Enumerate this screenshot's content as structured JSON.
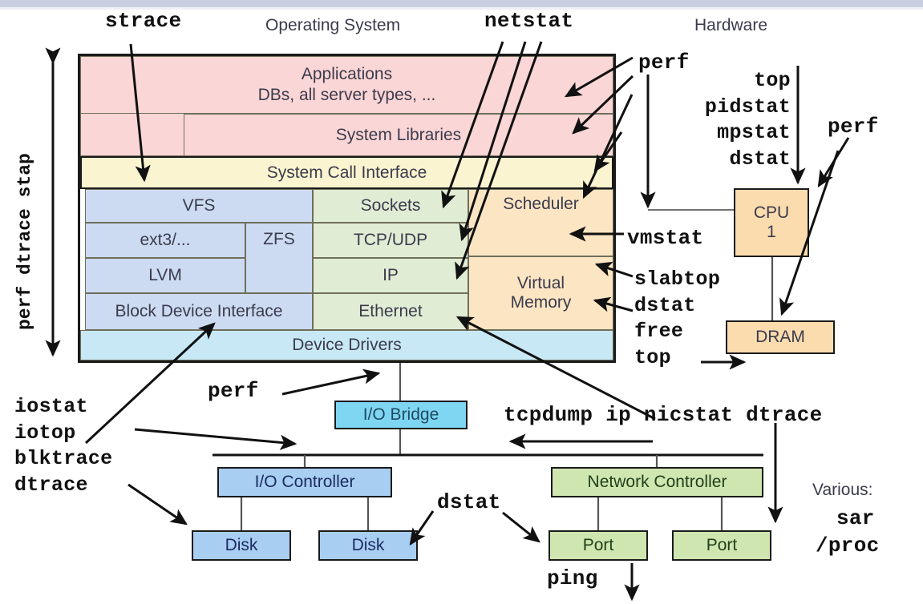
{
  "diagram": {
    "title_os": "Operating System",
    "title_hw": "Hardware",
    "various_label": "Various:"
  },
  "os_stack": {
    "applications": "Applications",
    "applications_sub": "DBs, all server types, ...",
    "system_libraries": "System Libraries",
    "system_call_interface": "System Call Interface",
    "vfs": "VFS",
    "ext3": "ext3/...",
    "zfs": "ZFS",
    "lvm": "LVM",
    "block_device_interface": "Block Device Interface",
    "sockets": "Sockets",
    "tcp_udp": "TCP/UDP",
    "ip": "IP",
    "ethernet": "Ethernet",
    "scheduler": "Scheduler",
    "virtual_memory_line1": "Virtual",
    "virtual_memory_line2": "Memory",
    "device_drivers": "Device Drivers"
  },
  "hardware": {
    "cpu_line1": "CPU",
    "cpu_line2": "1",
    "dram": "DRAM",
    "io_bridge": "I/O Bridge",
    "io_controller": "I/O Controller",
    "network_controller": "Network Controller",
    "disk_1": "Disk",
    "disk_2": "Disk",
    "port_1": "Port",
    "port_2": "Port"
  },
  "tools": {
    "left_axis": "perf dtrace stap",
    "strace": "strace",
    "netstat": "netstat",
    "perf_top_right": "perf",
    "cpu_tools": "top\npidstat\nmpstat\ndstat",
    "perf_far_right": "perf",
    "vmstat": "vmstat",
    "mem_tools": "slabtop\ndstat\nfree\ntop",
    "io_tools": "iostat\niotop\nblktrace\ndtrace",
    "perf_bridge": "perf",
    "net_tools": "tcpdump ip nicstat dtrace",
    "dstat_disk": "dstat",
    "ping": "ping",
    "sar": "sar",
    "proc": "/proc"
  }
}
